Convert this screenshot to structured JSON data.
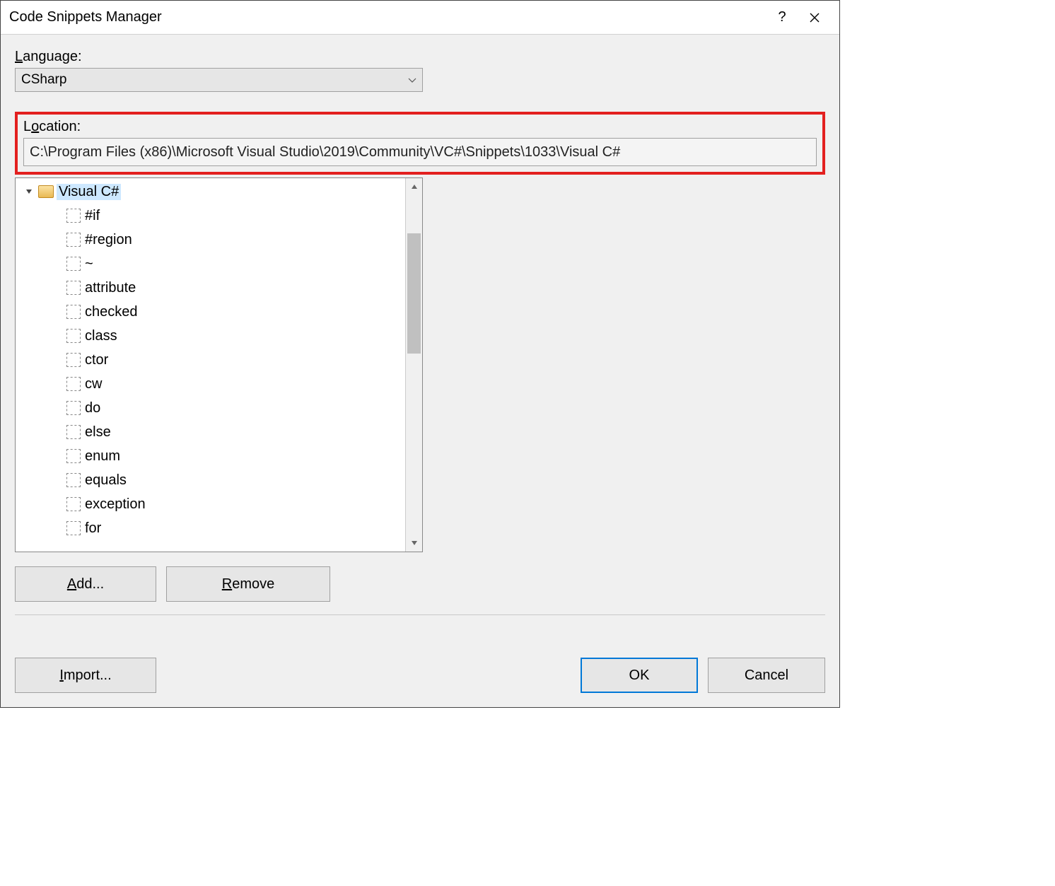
{
  "dialog": {
    "title": "Code Snippets Manager"
  },
  "language": {
    "label": "Language:",
    "value": "CSharp"
  },
  "location": {
    "label": "Location:",
    "path": "C:\\Program Files (x86)\\Microsoft Visual Studio\\2019\\Community\\VC#\\Snippets\\1033\\Visual C#"
  },
  "tree": {
    "root": "Visual C#",
    "items": [
      "#if",
      "#region",
      "~",
      "attribute",
      "checked",
      "class",
      "ctor",
      "cw",
      "do",
      "else",
      "enum",
      "equals",
      "exception",
      "for"
    ]
  },
  "buttons": {
    "add": "Add...",
    "remove": "Remove",
    "import": "Import...",
    "ok": "OK",
    "cancel": "Cancel"
  }
}
